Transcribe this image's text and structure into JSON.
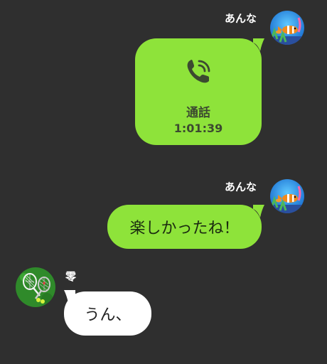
{
  "messages": [
    {
      "sender": "あんな",
      "type": "call",
      "call_label": "通話",
      "call_duration": "1:01:39",
      "icon": "phone-icon"
    },
    {
      "sender": "あんな",
      "type": "text",
      "text": "楽しかったね！"
    },
    {
      "sender": "零",
      "type": "text",
      "text": "うん、"
    }
  ],
  "colors": {
    "background": "#2f2f2f",
    "outgoing_bubble": "#8ee33a",
    "incoming_bubble": "#ffffff",
    "name_text": "#ffffff"
  },
  "avatars": {
    "anna": "clownfish-avatar",
    "rei": "tennis-rackets-avatar"
  }
}
